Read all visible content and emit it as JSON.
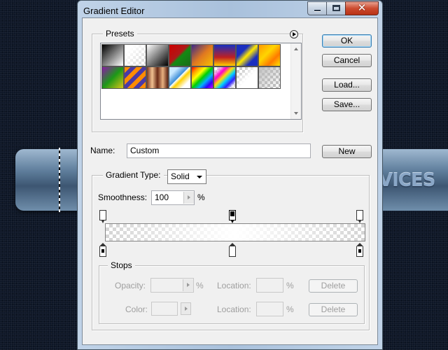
{
  "background": {
    "banner_text": "VICES"
  },
  "window": {
    "title": "Gradient Editor",
    "controls": {
      "minimize": "minimize",
      "maximize": "maximize",
      "close_glyph": "✕"
    }
  },
  "presets": {
    "label": "Presets",
    "flyout_icon": "play-circle-icon",
    "swatches": [
      "black-white",
      "white-transparent",
      "white-black",
      "red-green",
      "violet-orange",
      "blue-red-yellow",
      "blue-yellow-blue",
      "orange-yellow-orange",
      "violet-green-orange",
      "orange-violet-stripes",
      "copper",
      "chrome",
      "spectrum",
      "transparent-rainbow",
      "transparent-stripes",
      "neutral-density"
    ]
  },
  "buttons": {
    "ok": "OK",
    "cancel": "Cancel",
    "load": "Load...",
    "save": "Save...",
    "new": "New"
  },
  "name": {
    "label": "Name:",
    "value": "Custom"
  },
  "gradient": {
    "type_label": "Gradient Type:",
    "type_value": "Solid",
    "smoothness_label": "Smoothness:",
    "smoothness_value": "100",
    "smoothness_unit": "%",
    "opacity_stops": [
      {
        "location": 0,
        "selected": false
      },
      {
        "location": 50,
        "selected": true
      },
      {
        "location": 100,
        "selected": false
      }
    ],
    "color_stops": [
      {
        "location": 0,
        "color": "#000000"
      },
      {
        "location": 50,
        "color": "#ffffff"
      },
      {
        "location": 100,
        "color": "#000000"
      }
    ]
  },
  "stops": {
    "label": "Stops",
    "opacity_label": "Opacity:",
    "opacity_unit": "%",
    "location_label": "Location:",
    "location_unit": "%",
    "color_label": "Color:",
    "delete": "Delete"
  }
}
